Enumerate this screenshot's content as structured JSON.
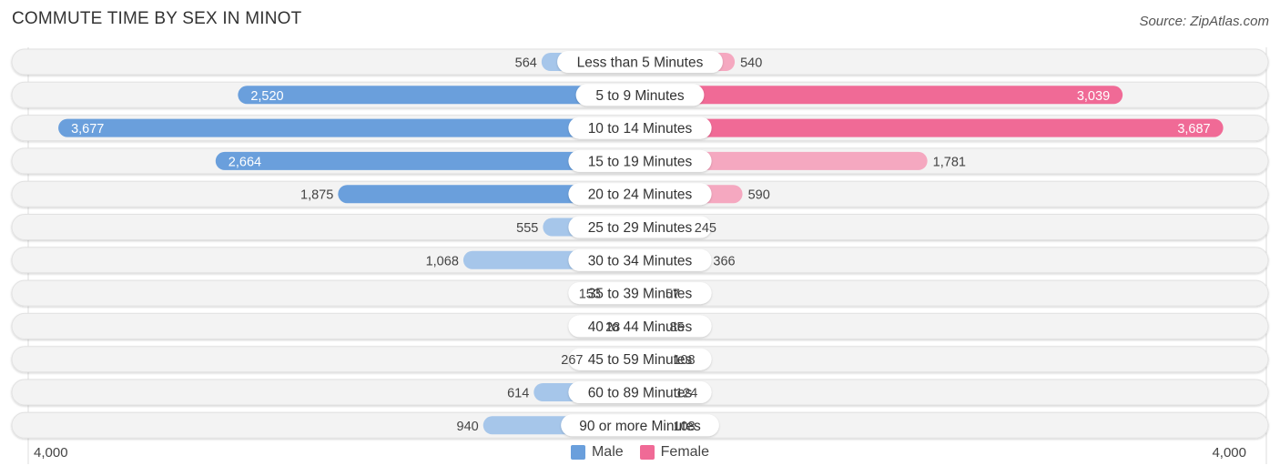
{
  "header": {
    "title": "COMMUTE TIME BY SEX IN MINOT",
    "source": "Source: ZipAtlas.com"
  },
  "colors": {
    "male_strong": "#6a9fdc",
    "male_light": "#a6c6ea",
    "female_strong": "#f06a96",
    "female_light": "#f5a8c0",
    "track": "#f3f3f3"
  },
  "chart_data": {
    "type": "bar",
    "orientation": "horizontal-diverging",
    "title": "COMMUTE TIME BY SEX IN MINOT",
    "categories": [
      "Less than 5 Minutes",
      "5 to 9 Minutes",
      "10 to 14 Minutes",
      "15 to 19 Minutes",
      "20 to 24 Minutes",
      "25 to 29 Minutes",
      "30 to 34 Minutes",
      "35 to 39 Minutes",
      "40 to 44 Minutes",
      "45 to 59 Minutes",
      "60 to 89 Minutes",
      "90 or more Minutes"
    ],
    "series": [
      {
        "name": "Male",
        "values": [
          564,
          2520,
          3677,
          2664,
          1875,
          555,
          1068,
          153,
          28,
          267,
          614,
          940
        ]
      },
      {
        "name": "Female",
        "values": [
          540,
          3039,
          3687,
          1781,
          590,
          245,
          366,
          57,
          85,
          108,
          124,
          108
        ]
      }
    ],
    "value_labels": {
      "Male": [
        "564",
        "2,520",
        "3,677",
        "2,664",
        "1,875",
        "555",
        "1,068",
        "153",
        "28",
        "267",
        "614",
        "940"
      ],
      "Female": [
        "540",
        "3,039",
        "3,687",
        "1,781",
        "590",
        "245",
        "366",
        "57",
        "85",
        "108",
        "124",
        "108"
      ]
    },
    "xlim": [
      -4000,
      4000
    ],
    "axis_tick_labels": {
      "left": "4,000",
      "right": "4,000"
    },
    "legend": {
      "position": "bottom-center",
      "items": [
        "Male",
        "Female"
      ]
    },
    "grid": false
  }
}
